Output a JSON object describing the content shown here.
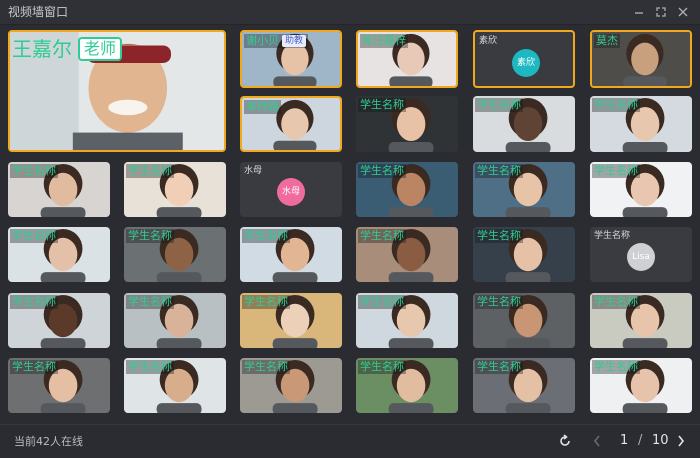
{
  "window": {
    "title": "视频墙窗口"
  },
  "featured": {
    "name": "王嘉尔",
    "role": "老师"
  },
  "tiles": [
    {
      "name": "谢小贝",
      "role": "助教",
      "photo": "#9fb5c8",
      "skin": "#e6c2a6",
      "active": true
    },
    {
      "name": "陈汪曼梓",
      "photo": "#e7e3e2",
      "skin": "#e8c9b7",
      "active": true
    },
    {
      "name": "素欣",
      "avatar": "素欣",
      "avatarColor": "#1eb8c1",
      "active": true
    },
    {
      "name": "莫杰",
      "photo": "#4f4d4a",
      "skin": "#c9a07d",
      "active": true
    },
    {
      "name": "单梓路",
      "photo": "#cdd6de",
      "skin": "#e7c7ad",
      "active": true
    },
    {
      "name": "学生名称",
      "photo": "#2f3336",
      "skin": "#e8c2a6"
    },
    {
      "name": "学生名称",
      "photo": "#d9dcdf",
      "skin": "#5f4334"
    },
    {
      "name": "学生名称",
      "photo": "#d5dae0",
      "skin": "#e7c7ad"
    },
    {
      "name": "学生名称",
      "photo": "#d8d4d2",
      "skin": "#e1bba0"
    },
    {
      "name": "学生名称",
      "photo": "#e8e1d7",
      "skin": "#f0cfb6"
    },
    {
      "name": "水母",
      "avatar": "水母",
      "avatarColor": "#f06c9e"
    },
    {
      "name": "学生名称",
      "photo": "#3b5d73",
      "skin": "#bb8463"
    },
    {
      "name": "学生名称",
      "photo": "#4e6f86",
      "skin": "#e7c3a7"
    },
    {
      "name": "学生名称",
      "photo": "#f1f2f4",
      "skin": "#e9c6af"
    },
    {
      "name": "学生名称",
      "photo": "#dbe2e6",
      "skin": "#e4c0a8"
    },
    {
      "name": "学生名称",
      "photo": "#6b7072",
      "skin": "#8e6245"
    },
    {
      "name": "学生名称",
      "photo": "#d0dbe3",
      "skin": "#e2b695"
    },
    {
      "name": "学生名称",
      "photo": "#a78d7a",
      "skin": "#8a5d42"
    },
    {
      "name": "学生名称",
      "photo": "#36404a",
      "skin": "#e6c1a6"
    },
    {
      "name": "学生名称",
      "avatar": "Lisa",
      "avatarColor": "#cfd0d3"
    },
    {
      "name": "学生名称",
      "photo": "#cfd4d8",
      "skin": "#5b3a2a"
    },
    {
      "name": "学生名称",
      "photo": "#b8c0c4",
      "skin": "#d9b399"
    },
    {
      "name": "学生名称",
      "photo": "#d9b77a",
      "skin": "#edd0b8"
    },
    {
      "name": "学生名称",
      "photo": "#cfd7df",
      "skin": "#e8c7af"
    },
    {
      "name": "学生名称",
      "photo": "#5e6164",
      "skin": "#c99675"
    },
    {
      "name": "学生名称",
      "photo": "#c9cbc1",
      "skin": "#e8c5aa"
    },
    {
      "name": "学生名称",
      "photo": "#6d6f70",
      "skin": "#e5bfa3"
    },
    {
      "name": "学生名称",
      "photo": "#dfe4e6",
      "skin": "#d8ad8c"
    },
    {
      "name": "学生名称",
      "photo": "#9c9a93",
      "skin": "#c99876"
    },
    {
      "name": "学生名称",
      "photo": "#6b8e63",
      "skin": "#e2bc9f"
    },
    {
      "name": "学生名称",
      "photo": "#6b6f75",
      "skin": "#e4c0a4"
    },
    {
      "name": "学生名称",
      "photo": "#eef0f2",
      "skin": "#e6c3aa"
    }
  ],
  "footer": {
    "online_text": "当前42人在线",
    "page_current": "1",
    "page_separator": "/",
    "page_total": "10"
  },
  "colors": {
    "accent_border": "#f1a81c",
    "name_green": "#2fcc93",
    "background": "#2b2c31"
  }
}
